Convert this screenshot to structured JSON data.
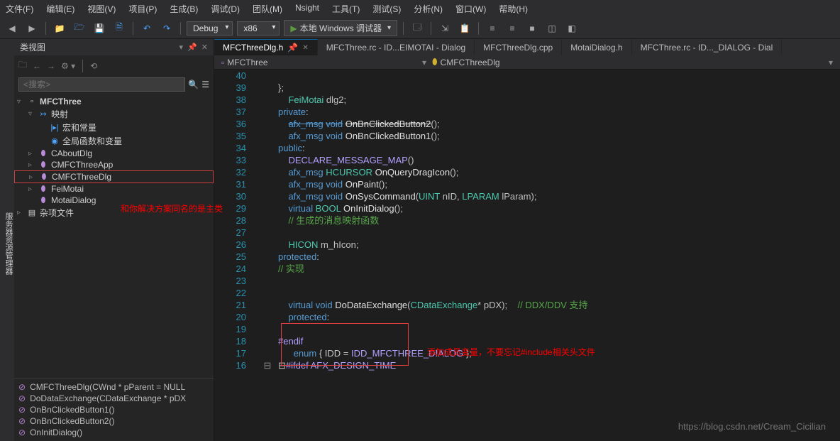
{
  "menu": [
    "文件(F)",
    "编辑(E)",
    "视图(V)",
    "项目(P)",
    "生成(B)",
    "调试(D)",
    "团队(M)",
    "Nsight",
    "工具(T)",
    "测试(S)",
    "分析(N)",
    "窗口(W)",
    "帮助(H)"
  ],
  "toolbar": {
    "config": "Debug",
    "platform": "x86",
    "debugger": "本地 Windows 调试器"
  },
  "vtab": "服务器资源管理器",
  "panel": {
    "title": "类视图",
    "search_placeholder": "<搜索>"
  },
  "tree": [
    {
      "d": 0,
      "arrow": "▿",
      "ico": "▫",
      "label": "MFCThree",
      "cls": "",
      "bold": true
    },
    {
      "d": 1,
      "arrow": "▿",
      "ico": "↣",
      "label": "映射",
      "cls": "blueico"
    },
    {
      "d": 2,
      "arrow": "",
      "ico": "|▸|",
      "label": "宏和常量",
      "cls": "blueico"
    },
    {
      "d": 2,
      "arrow": "",
      "ico": "◉",
      "label": "全局函数和变量",
      "cls": "blueico"
    },
    {
      "d": 1,
      "arrow": "▹",
      "ico": "⬮",
      "label": "CAboutDlg",
      "cls": "purple"
    },
    {
      "d": 1,
      "arrow": "▹",
      "ico": "⬮",
      "label": "CMFCThreeApp",
      "cls": "purple"
    },
    {
      "d": 1,
      "arrow": "▹",
      "ico": "⬮",
      "label": "CMFCThreeDlg",
      "cls": "purple",
      "sel": true
    },
    {
      "d": 1,
      "arrow": "▹",
      "ico": "⬮",
      "label": "FeiMotai",
      "cls": "purple"
    },
    {
      "d": 1,
      "arrow": "",
      "ico": "⬮",
      "label": "MotaiDialog",
      "cls": "purple"
    },
    {
      "d": 0,
      "arrow": "▹",
      "ico": "▤",
      "label": "杂项文件",
      "cls": ""
    }
  ],
  "annotation1": "和你解决方案同名的是主类",
  "annotation2": "添加成员变量，不要忘记#include相关头文件",
  "members": [
    "CMFCThreeDlg(CWnd * pParent = NULL",
    "DoDataExchange(CDataExchange * pDX",
    "OnBnClickedButton1()",
    "OnBnClickedButton2()",
    "OnInitDialog()"
  ],
  "tabs": [
    {
      "label": "MFCThreeDlg.h",
      "active": true,
      "pin": true
    },
    {
      "label": "MFCThree.rc - ID...EIMOTAI - Dialog"
    },
    {
      "label": "MFCThreeDlg.cpp"
    },
    {
      "label": "MotaiDialog.h"
    },
    {
      "label": "MFCThree.rc - ID..._DIALOG - Dial"
    }
  ],
  "crumbs": {
    "project": "MFCThree",
    "class": "CMFCThreeDlg"
  },
  "code": [
    {
      "n": 16,
      "t": [
        {
          "c": "punc",
          "s": "⊟"
        },
        {
          "c": "macro",
          "s": "#ifdef"
        },
        {
          "c": "punc",
          "s": " "
        },
        {
          "c": "macro",
          "s": "AFX_DESIGN_TIME"
        }
      ]
    },
    {
      "n": 17,
      "t": [
        {
          "c": "punc",
          "s": "      "
        },
        {
          "c": "kw",
          "s": "enum"
        },
        {
          "c": "punc",
          "s": " { "
        },
        {
          "c": "ident",
          "s": "IDD"
        },
        {
          "c": "punc",
          "s": " = "
        },
        {
          "c": "macro",
          "s": "IDD_MFCTHREE_DIALOG"
        },
        {
          "c": "punc",
          "s": " };"
        }
      ]
    },
    {
      "n": 18,
      "t": [
        {
          "c": "macro",
          "s": "#endif"
        }
      ]
    },
    {
      "n": 19,
      "t": [
        {
          "c": "punc",
          "s": ""
        }
      ]
    },
    {
      "n": 20,
      "t": [
        {
          "c": "punc",
          "s": "    "
        },
        {
          "c": "kw",
          "s": "protected"
        },
        {
          "c": "punc",
          "s": ":"
        }
      ]
    },
    {
      "n": 21,
      "t": [
        {
          "c": "punc",
          "s": "    "
        },
        {
          "c": "kw",
          "s": "virtual"
        },
        {
          "c": "punc",
          "s": " "
        },
        {
          "c": "kw",
          "s": "void"
        },
        {
          "c": "punc",
          "s": " "
        },
        {
          "c": "func",
          "s": "DoDataExchange"
        },
        {
          "c": "punc",
          "s": "("
        },
        {
          "c": "type",
          "s": "CDataExchange"
        },
        {
          "c": "punc",
          "s": "* pDX);    "
        },
        {
          "c": "cmt",
          "s": "// DDX/DDV 支持"
        }
      ]
    },
    {
      "n": 22,
      "t": [
        {
          "c": "punc",
          "s": ""
        }
      ]
    },
    {
      "n": 23,
      "t": [
        {
          "c": "punc",
          "s": ""
        }
      ]
    },
    {
      "n": 24,
      "t": [
        {
          "c": "cmt",
          "s": "// 实现"
        }
      ]
    },
    {
      "n": 25,
      "t": [
        {
          "c": "kw",
          "s": "protected"
        },
        {
          "c": "punc",
          "s": ":"
        }
      ]
    },
    {
      "n": 26,
      "t": [
        {
          "c": "punc",
          "s": "    "
        },
        {
          "c": "type",
          "s": "HICON"
        },
        {
          "c": "punc",
          "s": " m_hIcon;"
        }
      ]
    },
    {
      "n": 27,
      "t": [
        {
          "c": "punc",
          "s": ""
        }
      ]
    },
    {
      "n": 28,
      "t": [
        {
          "c": "punc",
          "s": "    "
        },
        {
          "c": "cmt",
          "s": "// 生成的消息映射函数"
        }
      ]
    },
    {
      "n": 29,
      "t": [
        {
          "c": "punc",
          "s": "    "
        },
        {
          "c": "kw",
          "s": "virtual"
        },
        {
          "c": "punc",
          "s": " "
        },
        {
          "c": "type",
          "s": "BOOL"
        },
        {
          "c": "punc",
          "s": " "
        },
        {
          "c": "func",
          "s": "OnInitDialog"
        },
        {
          "c": "punc",
          "s": "();"
        }
      ]
    },
    {
      "n": 30,
      "t": [
        {
          "c": "punc",
          "s": "    "
        },
        {
          "c": "kw",
          "s": "afx_msg"
        },
        {
          "c": "punc",
          "s": " "
        },
        {
          "c": "kw",
          "s": "void"
        },
        {
          "c": "punc",
          "s": " "
        },
        {
          "c": "func",
          "s": "OnSysCommand"
        },
        {
          "c": "punc",
          "s": "("
        },
        {
          "c": "type",
          "s": "UINT"
        },
        {
          "c": "punc",
          "s": " nID, "
        },
        {
          "c": "type",
          "s": "LPARAM"
        },
        {
          "c": "punc",
          "s": " lParam);"
        }
      ]
    },
    {
      "n": 31,
      "t": [
        {
          "c": "punc",
          "s": "    "
        },
        {
          "c": "kw",
          "s": "afx_msg"
        },
        {
          "c": "punc",
          "s": " "
        },
        {
          "c": "kw",
          "s": "void"
        },
        {
          "c": "punc",
          "s": " "
        },
        {
          "c": "func",
          "s": "OnPaint"
        },
        {
          "c": "punc",
          "s": "();"
        }
      ]
    },
    {
      "n": 32,
      "t": [
        {
          "c": "punc",
          "s": "    "
        },
        {
          "c": "kw",
          "s": "afx_msg"
        },
        {
          "c": "punc",
          "s": " "
        },
        {
          "c": "type",
          "s": "HCURSOR"
        },
        {
          "c": "punc",
          "s": " "
        },
        {
          "c": "func",
          "s": "OnQueryDragIcon"
        },
        {
          "c": "punc",
          "s": "();"
        }
      ]
    },
    {
      "n": 33,
      "t": [
        {
          "c": "punc",
          "s": "    "
        },
        {
          "c": "macro",
          "s": "DECLARE_MESSAGE_MAP"
        },
        {
          "c": "punc",
          "s": "()"
        }
      ]
    },
    {
      "n": 34,
      "t": [
        {
          "c": "kw",
          "s": "public"
        },
        {
          "c": "punc",
          "s": ":"
        }
      ]
    },
    {
      "n": 35,
      "t": [
        {
          "c": "punc",
          "s": "    "
        },
        {
          "c": "kw",
          "s": "afx_msg"
        },
        {
          "c": "punc",
          "s": " "
        },
        {
          "c": "kw",
          "s": "void"
        },
        {
          "c": "punc",
          "s": " "
        },
        {
          "c": "func",
          "s": "OnBnClickedButton1"
        },
        {
          "c": "punc",
          "s": "();"
        }
      ]
    },
    {
      "n": 36,
      "t": [
        {
          "c": "punc",
          "s": "    "
        },
        {
          "c": "kw",
          "s": "afx_msg"
        },
        {
          "c": "punc",
          "s": " "
        },
        {
          "c": "kw",
          "s": "void"
        },
        {
          "c": "punc",
          "s": " "
        },
        {
          "c": "func",
          "s": "OnBnClickedButton2"
        },
        {
          "c": "punc",
          "s": "();"
        }
      ],
      "strike": true
    },
    {
      "n": 37,
      "t": [
        {
          "c": "kw",
          "s": "private"
        },
        {
          "c": "punc",
          "s": ":"
        }
      ]
    },
    {
      "n": 38,
      "t": [
        {
          "c": "punc",
          "s": "    "
        },
        {
          "c": "type",
          "s": "FeiMotai"
        },
        {
          "c": "punc",
          "s": " dlg2;"
        }
      ]
    },
    {
      "n": 39,
      "t": [
        {
          "c": "punc",
          "s": "};"
        }
      ]
    },
    {
      "n": 40,
      "t": [
        {
          "c": "punc",
          "s": ""
        }
      ]
    }
  ],
  "watermark": "https://blog.csdn.net/Cream_Cicilian"
}
